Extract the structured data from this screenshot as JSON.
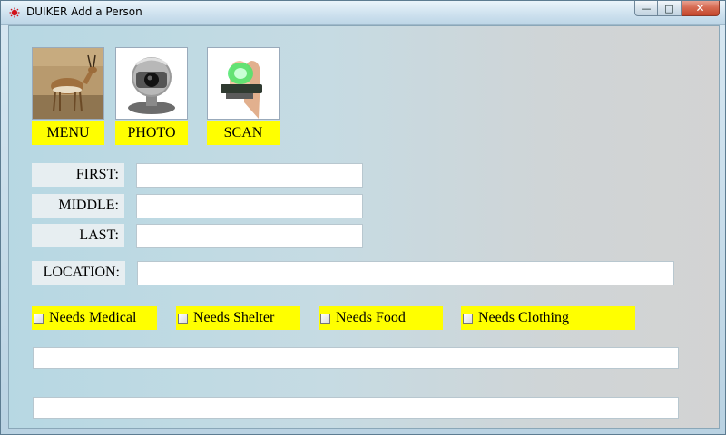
{
  "window": {
    "title": "DUIKER Add a Person",
    "controls": {
      "minimize": "—",
      "maximize": "□",
      "close": "✕"
    }
  },
  "tiles": [
    {
      "label": "MENU",
      "icon": "antelope-photo"
    },
    {
      "label": "PHOTO",
      "icon": "webcam-photo"
    },
    {
      "label": "SCAN",
      "icon": "fingerprint-scanner-photo"
    }
  ],
  "form": {
    "first_label": "FIRST:",
    "middle_label": "MIDDLE:",
    "last_label": "LAST:",
    "location_label": "LOCATION:",
    "first_value": "",
    "middle_value": "",
    "last_value": "",
    "location_value": ""
  },
  "needs": [
    {
      "label": "Needs Medical",
      "checked": false
    },
    {
      "label": "Needs Shelter",
      "checked": false
    },
    {
      "label": "Needs Food",
      "checked": false
    },
    {
      "label": "Needs Clothing",
      "checked": false
    }
  ],
  "colors": {
    "highlight": "#ffff00",
    "label_bg": "#e7eef1"
  }
}
